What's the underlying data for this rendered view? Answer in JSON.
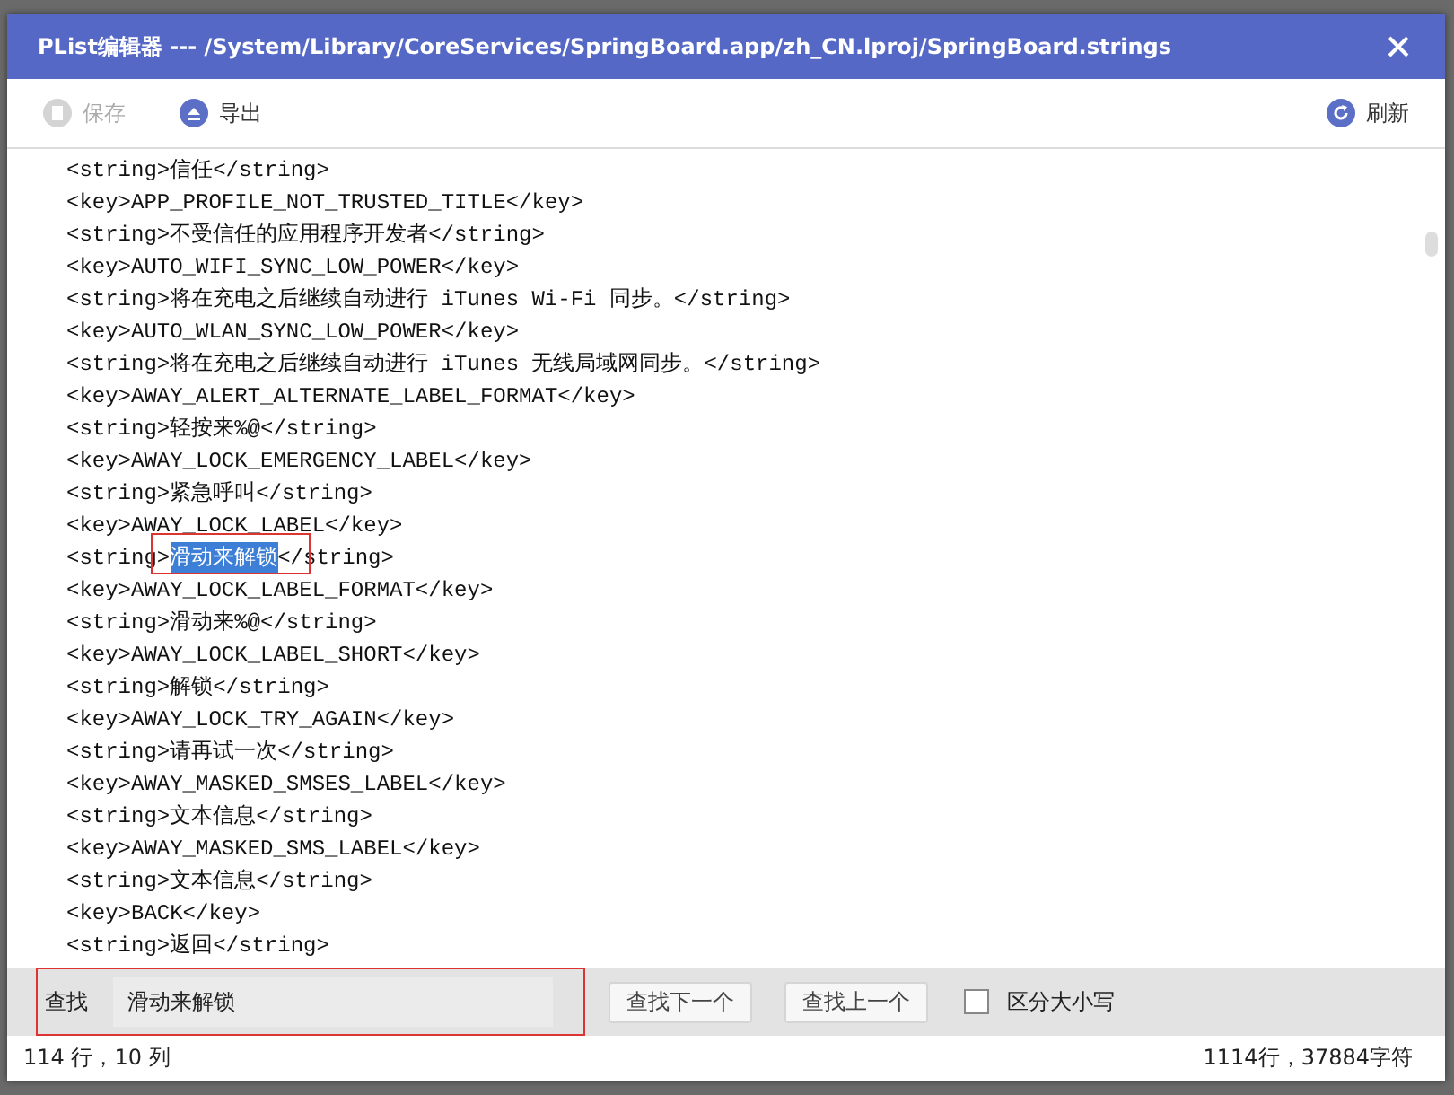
{
  "window": {
    "title": "PList编辑器 --- /System/Library/CoreServices/SpringBoard.app/zh_CN.lproj/SpringBoard.strings"
  },
  "toolbar": {
    "left": [
      {
        "kind": "save",
        "label": "保存",
        "disabled": true
      },
      {
        "kind": "export",
        "label": "导出",
        "disabled": false
      }
    ],
    "right": [
      {
        "kind": "refresh",
        "label": "刷新",
        "disabled": false
      }
    ]
  },
  "editor": {
    "lines": [
      {
        "kind": "text",
        "text": "<string>信任</string>"
      },
      {
        "kind": "text",
        "text": "<key>APP_PROFILE_NOT_TRUSTED_TITLE</key>"
      },
      {
        "kind": "text",
        "text": "<string>不受信任的应用程序开发者</string>"
      },
      {
        "kind": "text",
        "text": "<key>AUTO_WIFI_SYNC_LOW_POWER</key>"
      },
      {
        "kind": "text",
        "text": "<string>将在充电之后继续自动进行 iTunes Wi-Fi 同步。</string>"
      },
      {
        "kind": "text",
        "text": "<key>AUTO_WLAN_SYNC_LOW_POWER</key>"
      },
      {
        "kind": "text",
        "text": "<string>将在充电之后继续自动进行 iTunes 无线局域网同步。</string>"
      },
      {
        "kind": "text",
        "text": "<key>AWAY_ALERT_ALTERNATE_LABEL_FORMAT</key>"
      },
      {
        "kind": "text",
        "text": "<string>轻按来%@</string>"
      },
      {
        "kind": "text",
        "text": "<key>AWAY_LOCK_EMERGENCY_LABEL</key>"
      },
      {
        "kind": "text",
        "text": "<string>紧急呼叫</string>"
      },
      {
        "kind": "text",
        "text": "<key>AWAY_LOCK_LABEL</key>"
      },
      {
        "kind": "match",
        "before": "<string>",
        "match": "滑动来解锁",
        "after": "</string>"
      },
      {
        "kind": "text",
        "text": "<key>AWAY_LOCK_LABEL_FORMAT</key>"
      },
      {
        "kind": "text",
        "text": "<string>滑动来%@</string>"
      },
      {
        "kind": "text",
        "text": "<key>AWAY_LOCK_LABEL_SHORT</key>"
      },
      {
        "kind": "text",
        "text": "<string>解锁</string>"
      },
      {
        "kind": "text",
        "text": "<key>AWAY_LOCK_TRY_AGAIN</key>"
      },
      {
        "kind": "text",
        "text": "<string>请再试一次</string>"
      },
      {
        "kind": "text",
        "text": "<key>AWAY_MASKED_SMSES_LABEL</key>"
      },
      {
        "kind": "text",
        "text": "<string>文本信息</string>"
      },
      {
        "kind": "text",
        "text": "<key>AWAY_MASKED_SMS_LABEL</key>"
      },
      {
        "kind": "text",
        "text": "<string>文本信息</string>"
      },
      {
        "kind": "text",
        "text": "<key>BACK</key>"
      },
      {
        "kind": "text",
        "text": "<string>返回</string>"
      }
    ]
  },
  "find_bar": {
    "label": "查找",
    "value": "滑动来解锁",
    "buttons": [
      "查找下一个",
      "查找上一个"
    ],
    "match_case": {
      "label": "区分大小写",
      "checked": false
    }
  },
  "status_bar": {
    "position": "114 行，10 列",
    "summary": "1114行，37884字符"
  }
}
